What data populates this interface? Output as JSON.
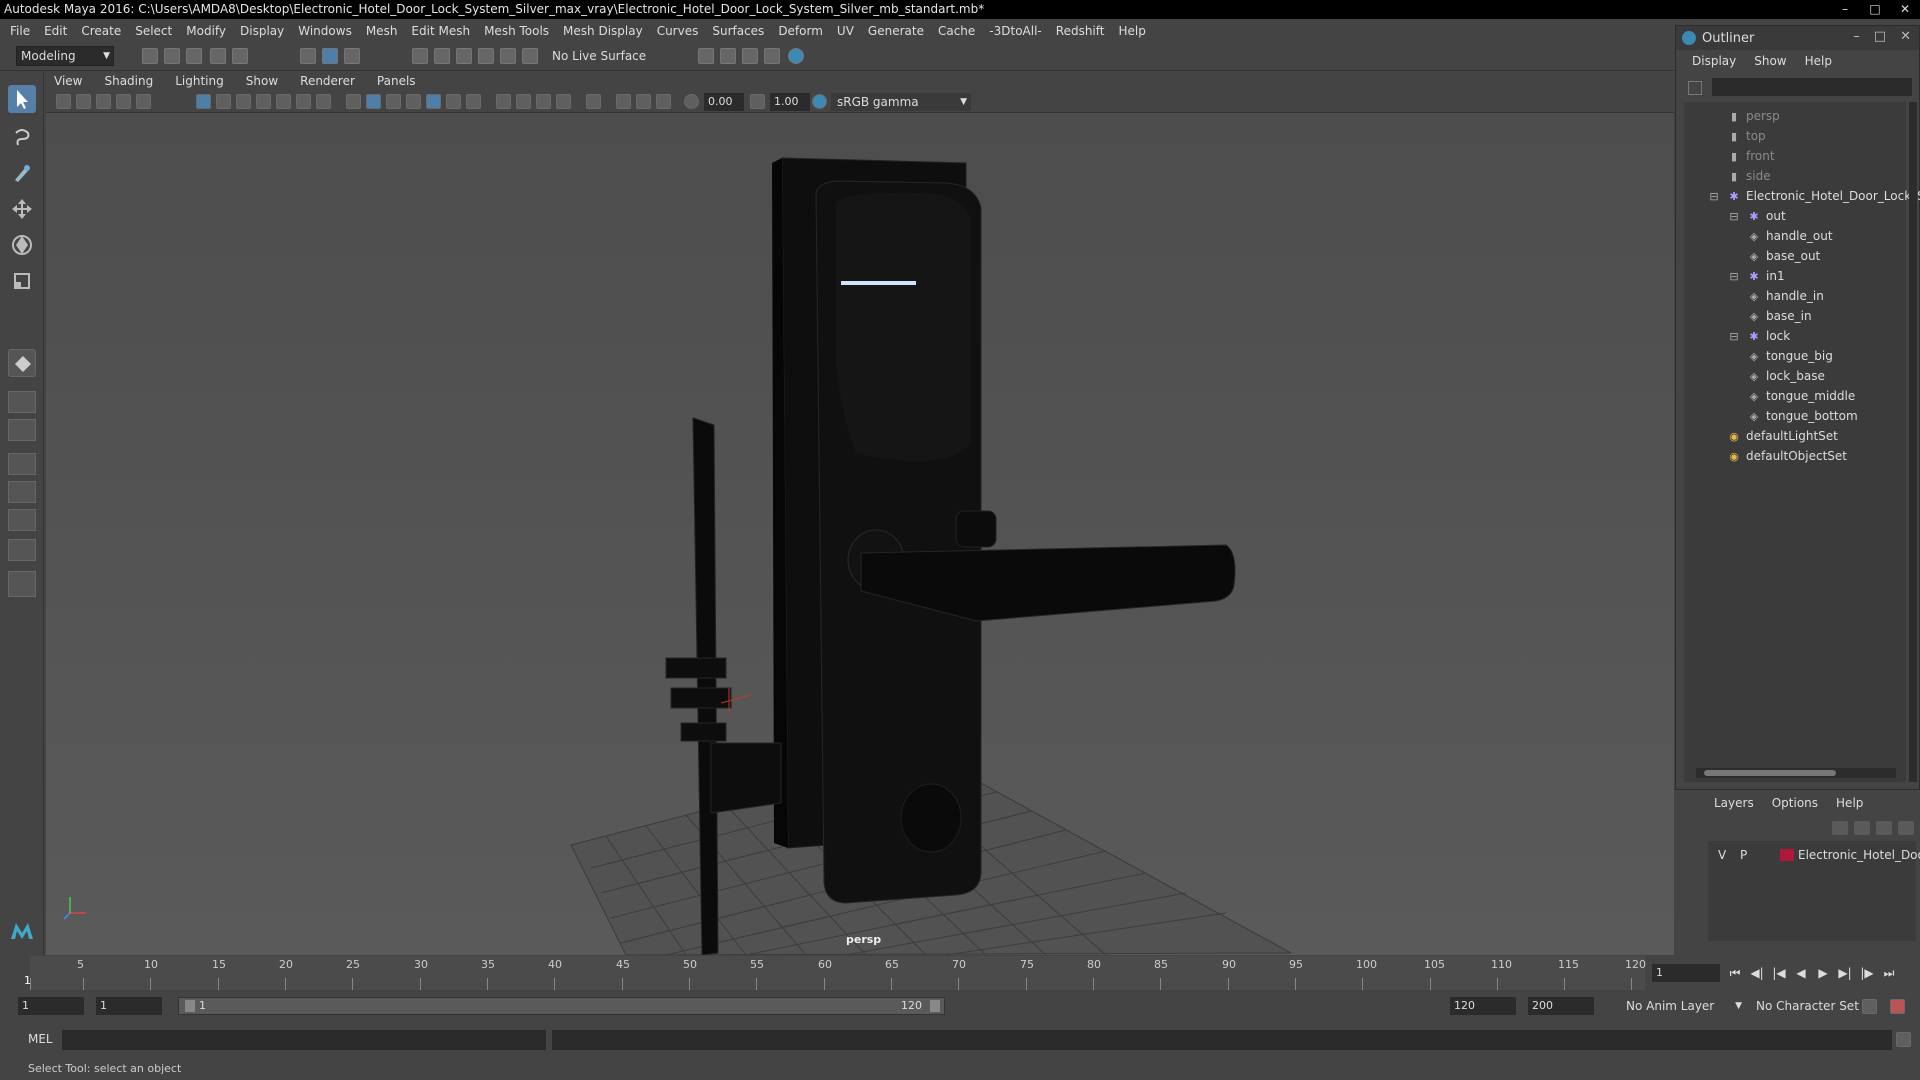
{
  "window": {
    "title": "Autodesk Maya 2016: C:\\Users\\AMDA8\\Desktop\\Electronic_Hotel_Door_Lock_System_Silver_max_vray\\Electronic_Hotel_Door_Lock_System_Silver_mb_standart.mb*",
    "min_icon": "minimize-icon",
    "max_icon": "maximize-icon",
    "close_icon": "close-icon"
  },
  "menubar": [
    "File",
    "Edit",
    "Create",
    "Select",
    "Modify",
    "Display",
    "Windows",
    "Mesh",
    "Edit Mesh",
    "Mesh Tools",
    "Mesh Display",
    "Curves",
    "Surfaces",
    "Deform",
    "UV",
    "Generate",
    "Cache",
    "-3DtoAll-",
    "Redshift",
    "Help"
  ],
  "shelf": {
    "mode": "Modeling",
    "live_surface": "No Live Surface"
  },
  "panel": {
    "menu": [
      "View",
      "Shading",
      "Lighting",
      "Show",
      "Renderer",
      "Panels"
    ],
    "exposure": "0.00",
    "gamma": "1.00",
    "color_space": "sRGB gamma",
    "camera_label": "persp"
  },
  "outliner": {
    "title": "Outliner",
    "menu": [
      "Display",
      "Show",
      "Help"
    ],
    "items": [
      {
        "label": "persp",
        "icon": "camera-icon",
        "dim": true
      },
      {
        "label": "top",
        "icon": "camera-icon",
        "dim": true
      },
      {
        "label": "front",
        "icon": "camera-icon",
        "dim": true
      },
      {
        "label": "side",
        "icon": "camera-icon",
        "dim": true
      },
      {
        "label": "Electronic_Hotel_Door_Lock_Sy",
        "icon": "group-icon",
        "dim": false
      },
      {
        "label": "out",
        "icon": "group-icon",
        "dim": false
      },
      {
        "label": "handle_out",
        "icon": "mesh-icon",
        "dim": false
      },
      {
        "label": "base_out",
        "icon": "mesh-icon",
        "dim": false
      },
      {
        "label": "in1",
        "icon": "group-icon",
        "dim": false
      },
      {
        "label": "handle_in",
        "icon": "mesh-icon",
        "dim": false
      },
      {
        "label": "base_in",
        "icon": "mesh-icon",
        "dim": false
      },
      {
        "label": "lock",
        "icon": "group-icon",
        "dim": false
      },
      {
        "label": "tongue_big",
        "icon": "mesh-icon",
        "dim": false
      },
      {
        "label": "lock_base",
        "icon": "mesh-icon",
        "dim": false
      },
      {
        "label": "tongue_middle",
        "icon": "mesh-icon",
        "dim": false
      },
      {
        "label": "tongue_bottom",
        "icon": "mesh-icon",
        "dim": false
      },
      {
        "label": "defaultLightSet",
        "icon": "set-icon",
        "dim": false
      },
      {
        "label": "defaultObjectSet",
        "icon": "set-icon",
        "dim": false
      }
    ]
  },
  "layers": {
    "menu": [
      "Layers",
      "Options",
      "Help"
    ],
    "row": {
      "v": "V",
      "p": "P",
      "name": "Electronic_Hotel_Door",
      "color": "#b0183a"
    }
  },
  "timeline": {
    "ticks": [
      "5",
      "10",
      "15",
      "20",
      "25",
      "30",
      "35",
      "40",
      "45",
      "50",
      "55",
      "60",
      "65",
      "70",
      "75",
      "80",
      "85",
      "90",
      "95",
      "100",
      "105",
      "110",
      "115",
      "120"
    ],
    "start_label": "1",
    "current_frame": "1"
  },
  "range": {
    "start": "1",
    "playback_start": "1",
    "slider_start": "1",
    "slider_end": "120",
    "playback_end": "120",
    "end": "200",
    "anim_layer": "No Anim Layer",
    "character_set": "No Character Set"
  },
  "command": {
    "lang": "MEL"
  },
  "help_line": "Select Tool: select an object"
}
